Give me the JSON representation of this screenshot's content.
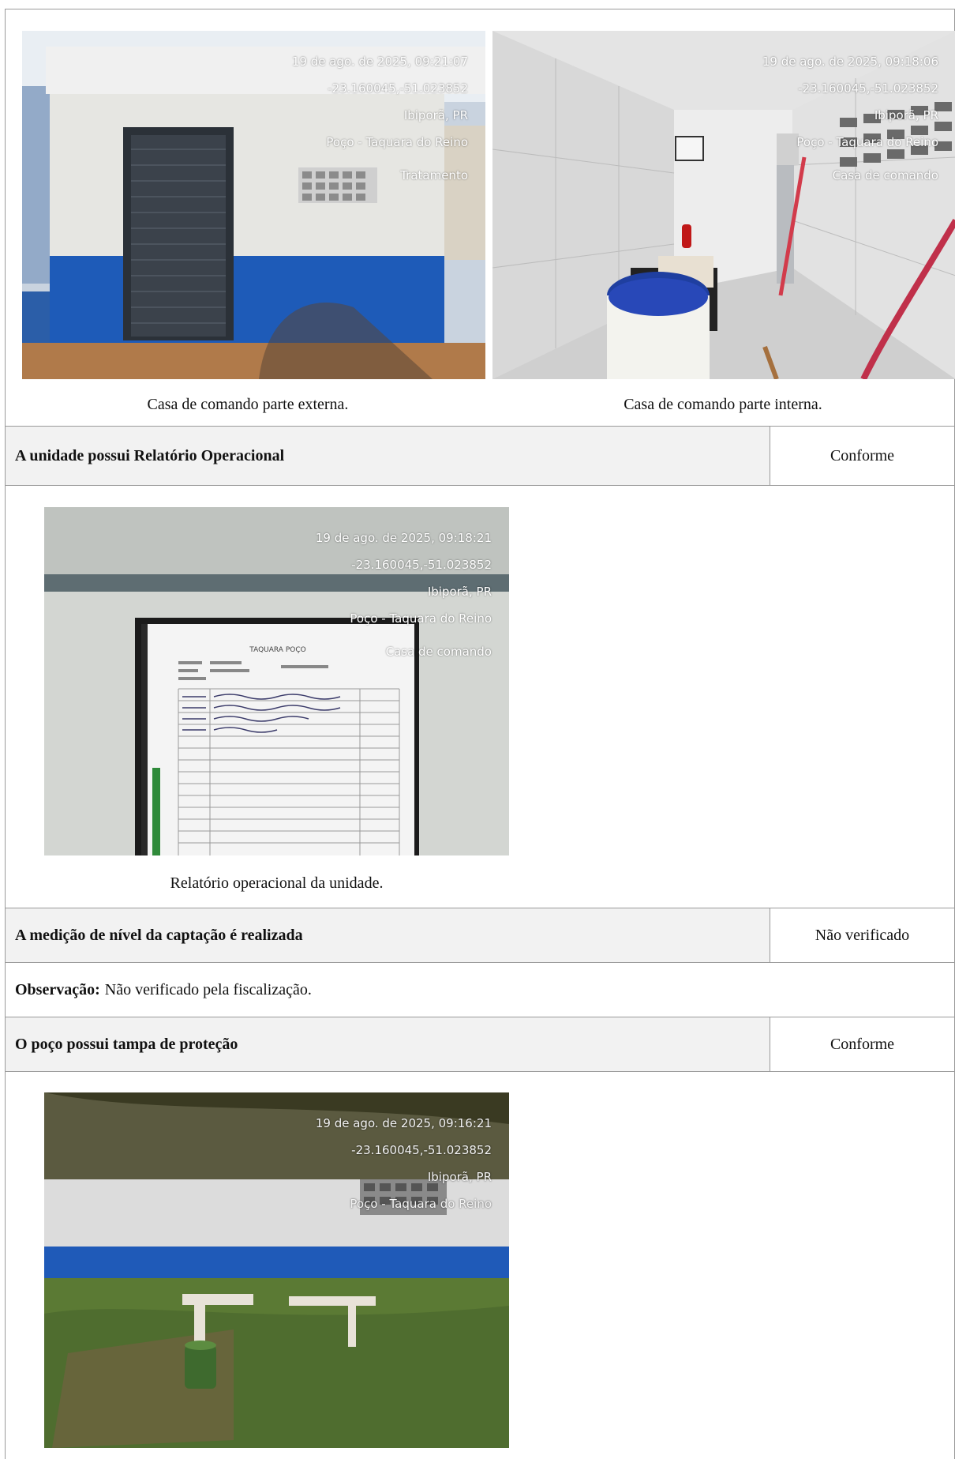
{
  "photos": [
    {
      "stamp": [
        "19 de ago. de 2025, 09:21:07",
        "-23.160045,-51.023852",
        "Ibiporã, PR",
        "Poço - Taquara do Reino"
      ],
      "tag": "Tratamento",
      "caption": "Casa de comando parte externa."
    },
    {
      "stamp": [
        "19 de ago. de 2025, 09:18:06",
        "-23.160045,-51.023852",
        "Ibiporã, PR",
        "Poço - Taquara do Reino"
      ],
      "tag": "Casa de comando",
      "caption": "Casa de comando parte interna."
    },
    {
      "stamp": [
        "19 de ago. de 2025, 09:18:21",
        "-23.160045,-51.023852",
        "Ibiporã, PR",
        "Poço - Taquara do Reino"
      ],
      "tag": "Casa de comando",
      "caption": "Relatório operacional da unidade.",
      "doc_title": "TAQUARA POÇO"
    },
    {
      "stamp": [
        "19 de ago. de 2025, 09:16:21",
        "-23.160045,-51.023852",
        "Ibiporã, PR",
        "Poço - Taquara do Reino"
      ]
    }
  ],
  "items": [
    {
      "question": "A unidade possui Relatório Operacional",
      "status": "Conforme"
    },
    {
      "question": "A medição de nível da captação é realizada",
      "status": "Não verificado",
      "observation_label": "Observação:",
      "observation_text": "Não verificado pela fiscalização."
    },
    {
      "question": "O poço possui tampa de proteção",
      "status": "Conforme"
    }
  ],
  "colors": {
    "header_bg": "#f2f2f2",
    "border": "#9a9a9a",
    "wall_blue": "#1e5bb8"
  }
}
